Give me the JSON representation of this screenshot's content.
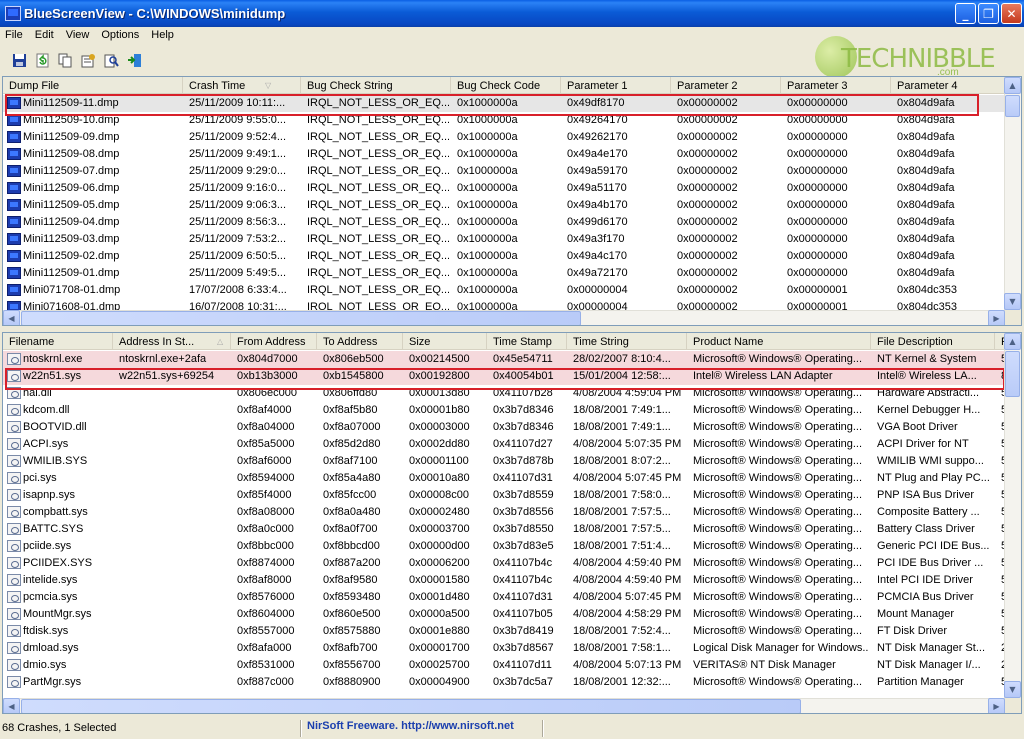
{
  "window": {
    "title": "BlueScreenView  -  C:\\WINDOWS\\minidump",
    "minimize": "_",
    "maximize": "❐",
    "close": "✕"
  },
  "menu": [
    "File",
    "Edit",
    "View",
    "Options",
    "Help"
  ],
  "toolbar": [
    "save-icon",
    "refresh-icon",
    "copy-icon",
    "properties-icon",
    "exit-icon"
  ],
  "logo": {
    "text": "TECHNIBBLE",
    "suffix": ".com"
  },
  "top_table": {
    "columns": [
      "Dump File",
      "Crash Time",
      "Bug Check String",
      "Bug Check Code",
      "Parameter 1",
      "Parameter 2",
      "Parameter 3",
      "Parameter 4"
    ],
    "rows": [
      [
        "Mini112509-11.dmp",
        "25/11/2009 10:11:...",
        "IRQL_NOT_LESS_OR_EQ...",
        "0x1000000a",
        "0x49df8170",
        "0x00000002",
        "0x00000000",
        "0x804d9afa"
      ],
      [
        "Mini112509-10.dmp",
        "25/11/2009 9:55:0...",
        "IRQL_NOT_LESS_OR_EQ...",
        "0x1000000a",
        "0x49264170",
        "0x00000002",
        "0x00000000",
        "0x804d9afa"
      ],
      [
        "Mini112509-09.dmp",
        "25/11/2009 9:52:4...",
        "IRQL_NOT_LESS_OR_EQ...",
        "0x1000000a",
        "0x49262170",
        "0x00000002",
        "0x00000000",
        "0x804d9afa"
      ],
      [
        "Mini112509-08.dmp",
        "25/11/2009 9:49:1...",
        "IRQL_NOT_LESS_OR_EQ...",
        "0x1000000a",
        "0x49a4e170",
        "0x00000002",
        "0x00000000",
        "0x804d9afa"
      ],
      [
        "Mini112509-07.dmp",
        "25/11/2009 9:29:0...",
        "IRQL_NOT_LESS_OR_EQ...",
        "0x1000000a",
        "0x49a59170",
        "0x00000002",
        "0x00000000",
        "0x804d9afa"
      ],
      [
        "Mini112509-06.dmp",
        "25/11/2009 9:16:0...",
        "IRQL_NOT_LESS_OR_EQ...",
        "0x1000000a",
        "0x49a51170",
        "0x00000002",
        "0x00000000",
        "0x804d9afa"
      ],
      [
        "Mini112509-05.dmp",
        "25/11/2009 9:06:3...",
        "IRQL_NOT_LESS_OR_EQ...",
        "0x1000000a",
        "0x49a4b170",
        "0x00000002",
        "0x00000000",
        "0x804d9afa"
      ],
      [
        "Mini112509-04.dmp",
        "25/11/2009 8:56:3...",
        "IRQL_NOT_LESS_OR_EQ...",
        "0x1000000a",
        "0x499d6170",
        "0x00000002",
        "0x00000000",
        "0x804d9afa"
      ],
      [
        "Mini112509-03.dmp",
        "25/11/2009 7:53:2...",
        "IRQL_NOT_LESS_OR_EQ...",
        "0x1000000a",
        "0x49a3f170",
        "0x00000002",
        "0x00000000",
        "0x804d9afa"
      ],
      [
        "Mini112509-02.dmp",
        "25/11/2009 6:50:5...",
        "IRQL_NOT_LESS_OR_EQ...",
        "0x1000000a",
        "0x49a4c170",
        "0x00000002",
        "0x00000000",
        "0x804d9afa"
      ],
      [
        "Mini112509-01.dmp",
        "25/11/2009 5:49:5...",
        "IRQL_NOT_LESS_OR_EQ...",
        "0x1000000a",
        "0x49a72170",
        "0x00000002",
        "0x00000000",
        "0x804d9afa"
      ],
      [
        "Mini071708-01.dmp",
        "17/07/2008 6:33:4...",
        "IRQL_NOT_LESS_OR_EQ...",
        "0x1000000a",
        "0x00000004",
        "0x00000002",
        "0x00000001",
        "0x804dc353"
      ],
      [
        "Mini071608-01.dmp",
        "16/07/2008 10:31:...",
        "IRQL_NOT_LESS_OR_EQ...",
        "0x1000000a",
        "0x00000004",
        "0x00000002",
        "0x00000001",
        "0x804dc353"
      ]
    ]
  },
  "bottom_table": {
    "columns": [
      "Filename",
      "Address In St...",
      "From Address",
      "To Address",
      "Size",
      "Time Stamp",
      "Time String",
      "Product Name",
      "File Description",
      "F"
    ],
    "rows": [
      [
        "ntoskrnl.exe",
        "ntoskrnl.exe+2afa",
        "0x804d7000",
        "0x806eb500",
        "0x00214500",
        "0x45e54711",
        "28/02/2007 8:10:4...",
        "Microsoft® Windows® Operating...",
        "NT Kernel & System",
        "5."
      ],
      [
        "w22n51.sys",
        "w22n51.sys+69254",
        "0xb13b3000",
        "0xb1545800",
        "0x00192800",
        "0x40054b01",
        "15/01/2004 12:58:...",
        "Intel® Wireless LAN Adapter",
        "Intel® Wireless LA...",
        "8"
      ],
      [
        "hal.dll",
        "",
        "0x806ec000",
        "0x806ffd80",
        "0x00013d80",
        "0x41107b28",
        "4/08/2004 4:59:04 PM",
        "Microsoft® Windows® Operating...",
        "Hardware Abstracti...",
        "5."
      ],
      [
        "kdcom.dll",
        "",
        "0xf8af4000",
        "0xf8af5b80",
        "0x00001b80",
        "0x3b7d8346",
        "18/08/2001 7:49:1...",
        "Microsoft® Windows® Operating...",
        "Kernel Debugger H...",
        "5."
      ],
      [
        "BOOTVID.dll",
        "",
        "0xf8a04000",
        "0xf8a07000",
        "0x00003000",
        "0x3b7d8346",
        "18/08/2001 7:49:1...",
        "Microsoft® Windows® Operating...",
        "VGA Boot Driver",
        "5."
      ],
      [
        "ACPI.sys",
        "",
        "0xf85a5000",
        "0xf85d2d80",
        "0x0002dd80",
        "0x41107d27",
        "4/08/2004 5:07:35 PM",
        "Microsoft® Windows® Operating...",
        "ACPI Driver for NT",
        "5."
      ],
      [
        "WMILIB.SYS",
        "",
        "0xf8af6000",
        "0xf8af7100",
        "0x00001100",
        "0x3b7d878b",
        "18/08/2001 8:07:2...",
        "Microsoft® Windows® Operating...",
        "WMILIB WMI suppo...",
        "5."
      ],
      [
        "pci.sys",
        "",
        "0xf8594000",
        "0xf85a4a80",
        "0x00010a80",
        "0x41107d31",
        "4/08/2004 5:07:45 PM",
        "Microsoft® Windows® Operating...",
        "NT Plug and Play PC...",
        "5."
      ],
      [
        "isapnp.sys",
        "",
        "0xf85f4000",
        "0xf85fcc00",
        "0x00008c00",
        "0x3b7d8559",
        "18/08/2001 7:58:0...",
        "Microsoft® Windows® Operating...",
        "PNP ISA Bus Driver",
        "5."
      ],
      [
        "compbatt.sys",
        "",
        "0xf8a08000",
        "0xf8a0a480",
        "0x00002480",
        "0x3b7d8556",
        "18/08/2001 7:57:5...",
        "Microsoft® Windows® Operating...",
        "Composite Battery ...",
        "5."
      ],
      [
        "BATTC.SYS",
        "",
        "0xf8a0c000",
        "0xf8a0f700",
        "0x00003700",
        "0x3b7d8550",
        "18/08/2001 7:57:5...",
        "Microsoft® Windows® Operating...",
        "Battery Class Driver",
        "5."
      ],
      [
        "pciide.sys",
        "",
        "0xf8bbc000",
        "0xf8bbcd00",
        "0x00000d00",
        "0x3b7d83e5",
        "18/08/2001 7:51:4...",
        "Microsoft® Windows® Operating...",
        "Generic PCI IDE Bus...",
        "5."
      ],
      [
        "PCIIDEX.SYS",
        "",
        "0xf8874000",
        "0xf887a200",
        "0x00006200",
        "0x41107b4c",
        "4/08/2004 4:59:40 PM",
        "Microsoft® Windows® Operating...",
        "PCI IDE Bus Driver ...",
        "5."
      ],
      [
        "intelide.sys",
        "",
        "0xf8af8000",
        "0xf8af9580",
        "0x00001580",
        "0x41107b4c",
        "4/08/2004 4:59:40 PM",
        "Microsoft® Windows® Operating...",
        "Intel PCI IDE Driver",
        "5."
      ],
      [
        "pcmcia.sys",
        "",
        "0xf8576000",
        "0xf8593480",
        "0x0001d480",
        "0x41107d31",
        "4/08/2004 5:07:45 PM",
        "Microsoft® Windows® Operating...",
        "PCMCIA Bus Driver",
        "5."
      ],
      [
        "MountMgr.sys",
        "",
        "0xf8604000",
        "0xf860e500",
        "0x0000a500",
        "0x41107b05",
        "4/08/2004 4:58:29 PM",
        "Microsoft® Windows® Operating...",
        "Mount Manager",
        "5."
      ],
      [
        "ftdisk.sys",
        "",
        "0xf8557000",
        "0xf8575880",
        "0x0001e880",
        "0x3b7d8419",
        "18/08/2001 7:52:4...",
        "Microsoft® Windows® Operating...",
        "FT Disk Driver",
        "5."
      ],
      [
        "dmload.sys",
        "",
        "0xf8afa000",
        "0xf8afb700",
        "0x00001700",
        "0x3b7d8567",
        "18/08/2001 7:58:1...",
        "Logical Disk Manager for Windows...",
        "NT Disk Manager St...",
        "2."
      ],
      [
        "dmio.sys",
        "",
        "0xf8531000",
        "0xf8556700",
        "0x00025700",
        "0x41107d11",
        "4/08/2004 5:07:13 PM",
        "VERITAS® NT Disk Manager",
        "NT Disk Manager I/...",
        "2."
      ],
      [
        "PartMgr.sys",
        "",
        "0xf887c000",
        "0xf8880900",
        "0x00004900",
        "0x3b7dc5a7",
        "18/08/2001 12:32:...",
        "Microsoft® Windows® Operating...",
        "Partition Manager",
        "5."
      ]
    ]
  },
  "status": {
    "left": "68 Crashes, 1 Selected",
    "middle": "NirSoft Freeware.  http://www.nirsoft.net"
  },
  "colors": {
    "highlight": "#d8202a",
    "selected_row": "#e6e6e6",
    "pink_row": "#f5d9dc"
  }
}
